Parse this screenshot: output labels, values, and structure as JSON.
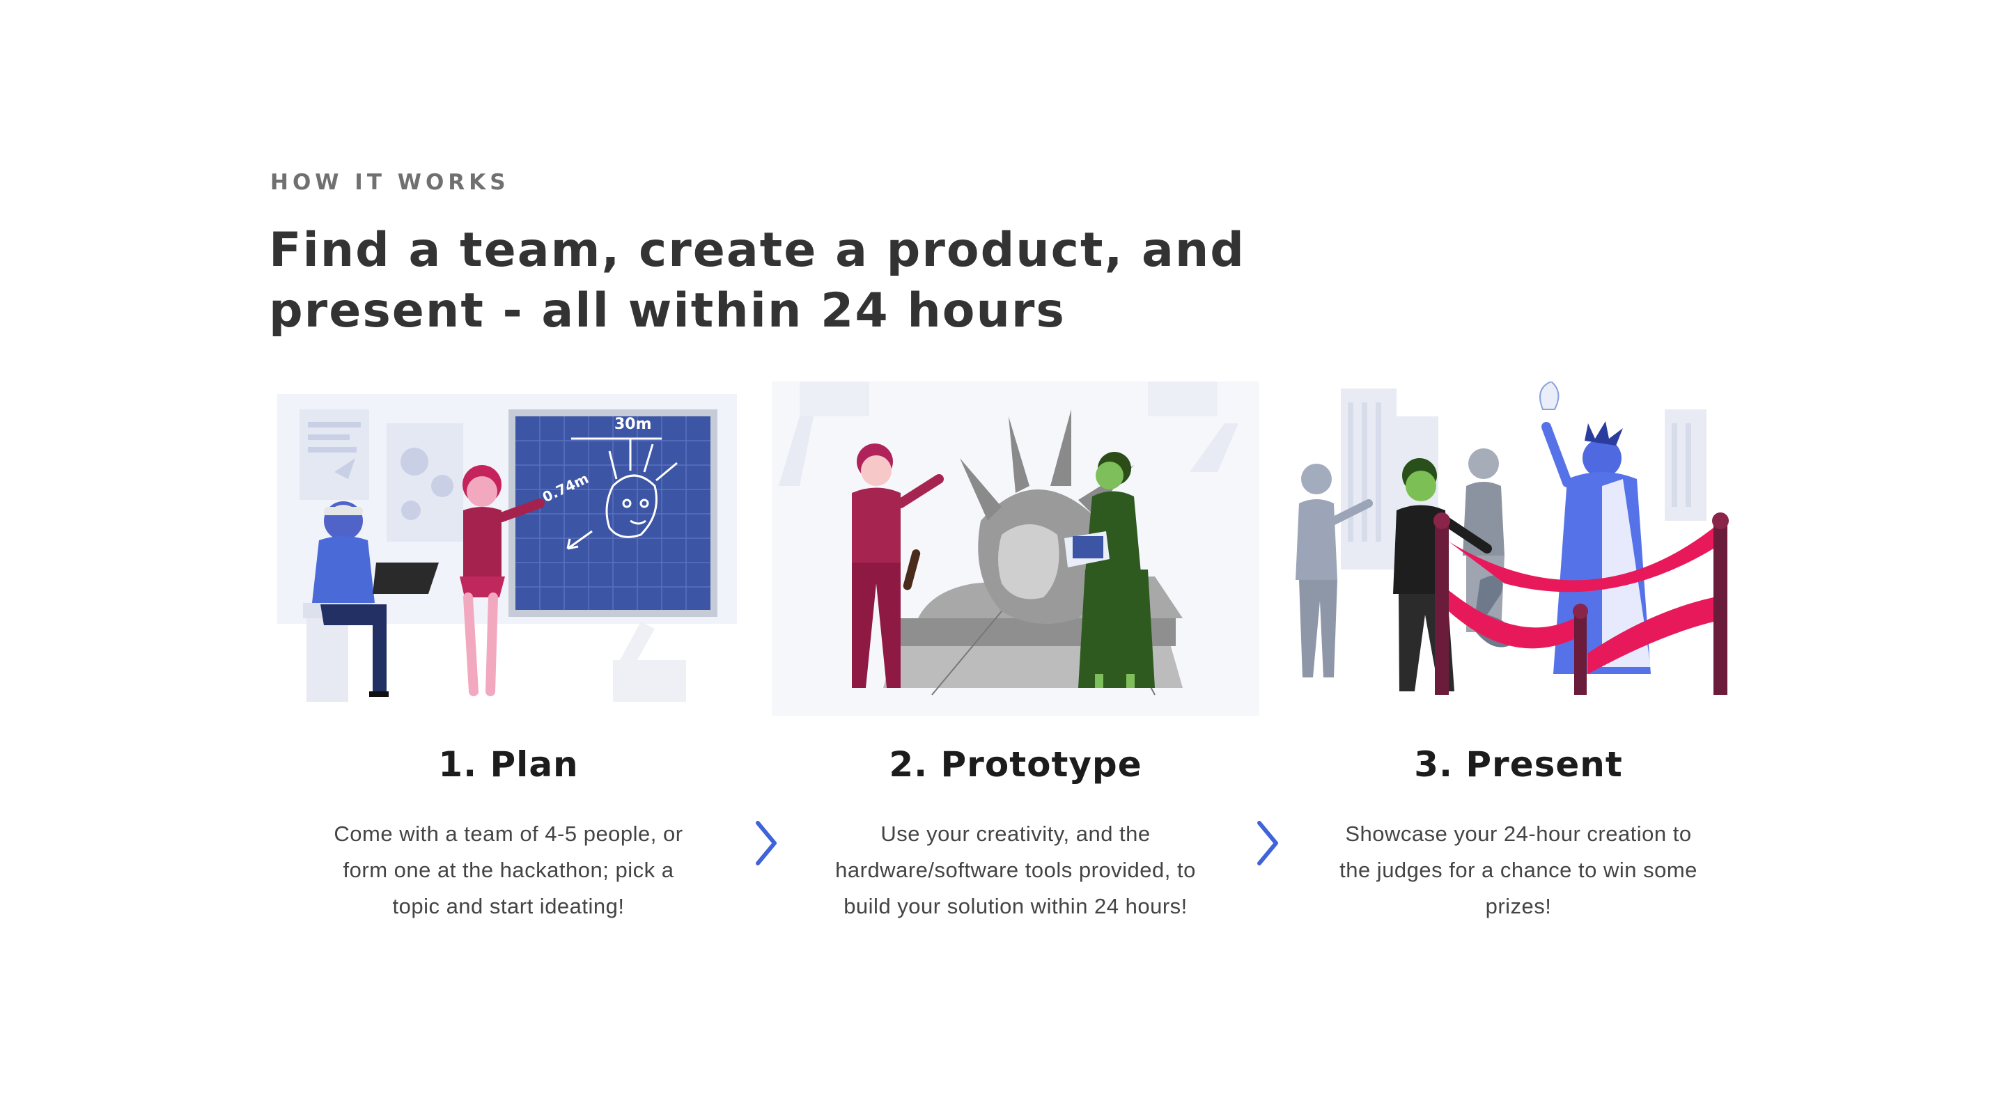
{
  "section": {
    "eyebrow": "HOW IT WORKS",
    "headline_line1": "Find a team, create a product, and",
    "headline_line2": "present - all within 24 hours"
  },
  "steps": [
    {
      "title": "1. Plan",
      "desc_lines": [
        "Come with a team of 4-5 people, or",
        "form one at the hackathon; pick a",
        "topic and start ideating!"
      ],
      "illustration": "team-planning-blueprint"
    },
    {
      "title": "2. Prototype",
      "desc_lines": [
        "Use your creativity, and the",
        "hardware/software tools provided, to",
        "build your solution within 24 hours!"
      ],
      "illustration": "team-building-statue"
    },
    {
      "title": "3. Present",
      "desc_lines": [
        "Showcase your 24-hour creation to",
        "the judges for a chance to win some",
        "prizes!"
      ],
      "illustration": "ribbon-cutting-presentation"
    }
  ],
  "blueprint_labels": {
    "top": "30m",
    "side": "0.74m"
  },
  "icons": [
    "chevron-right-icon",
    "chevron-right-icon"
  ],
  "colors": {
    "accent_chevron": "#3f63d8",
    "blueprint": "#3c55a5",
    "magenta": "#b0235a",
    "ribbon": "#e8195a",
    "green": "#2f5a1f",
    "text_dark": "#333333",
    "text_muted": "#707070"
  }
}
